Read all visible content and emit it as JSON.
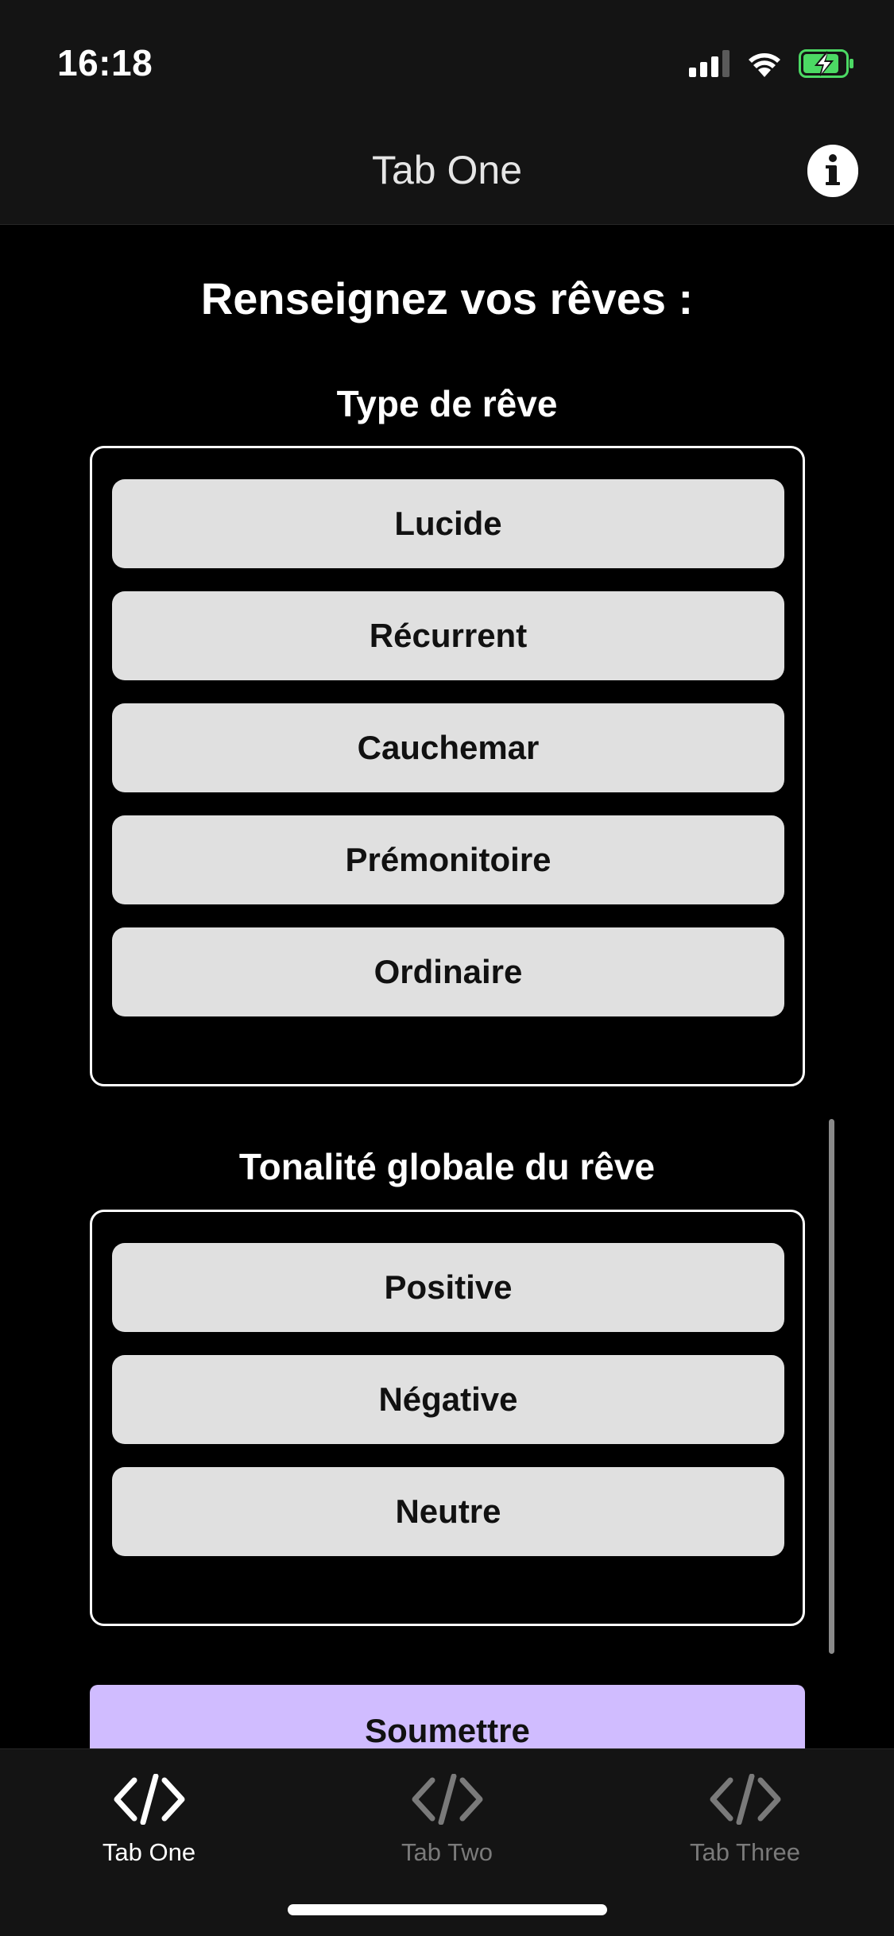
{
  "status_bar": {
    "time": "16:18"
  },
  "header": {
    "title": "Tab One",
    "info_icon": "info-circle-icon"
  },
  "main": {
    "page_title": "Renseignez vos rêves :",
    "dream_type": {
      "title": "Type de rêve",
      "options": [
        "Lucide",
        "Récurrent",
        "Cauchemar",
        "Prémonitoire",
        "Ordinaire"
      ]
    },
    "tone": {
      "title": "Tonalité globale du rêve",
      "options": [
        "Positive",
        "Négative",
        "Neutre"
      ]
    },
    "submit_label": "Soumettre"
  },
  "tabs": [
    {
      "label": "Tab One",
      "icon": "code-icon",
      "active": true
    },
    {
      "label": "Tab Two",
      "icon": "code-icon",
      "active": false
    },
    {
      "label": "Tab Three",
      "icon": "code-icon",
      "active": false
    }
  ],
  "colors": {
    "background": "#000000",
    "bar_background": "#141414",
    "option_background": "#e0e0e0",
    "submit_background": "#d0bcff",
    "battery_green": "#4cd964",
    "tab_inactive": "#7a7a7a"
  }
}
